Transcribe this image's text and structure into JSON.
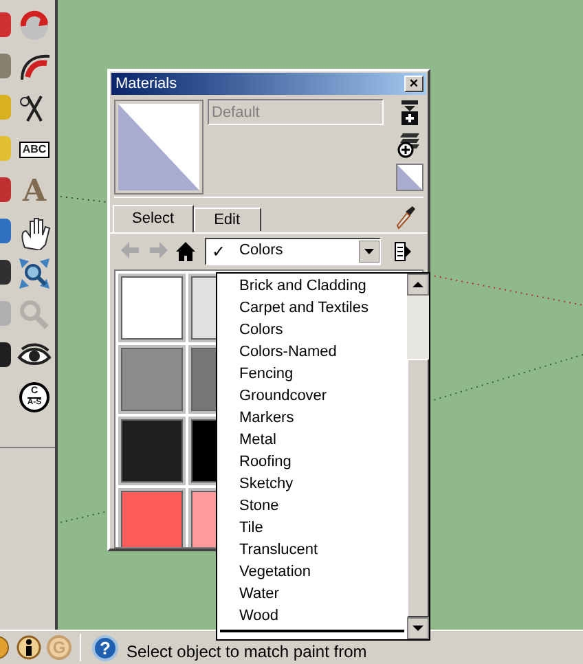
{
  "toolbar": {
    "left_tools": [
      {
        "color": "#d03030"
      },
      {
        "color": "#8a8070"
      },
      {
        "color": "#d8b020"
      },
      {
        "color": "#e0c030"
      },
      {
        "color": "#c03030"
      },
      {
        "color": "#3070c0"
      },
      {
        "color": "#303030"
      },
      {
        "color": "#b0b0b0"
      },
      {
        "color": "#202020"
      }
    ],
    "tools": [
      {
        "kind": "rotate",
        "disabled": false
      },
      {
        "kind": "offset",
        "disabled": false
      },
      {
        "kind": "tape",
        "disabled": false
      },
      {
        "kind": "text",
        "label": "ABC",
        "disabled": false
      },
      {
        "kind": "text3d",
        "label": "A",
        "disabled": false
      },
      {
        "kind": "pan",
        "disabled": false
      },
      {
        "kind": "zoom-extents",
        "disabled": false
      },
      {
        "kind": "zoom-window",
        "disabled": true
      },
      {
        "kind": "look-around",
        "disabled": false
      },
      {
        "kind": "section",
        "label": "C",
        "sublabel": "A-S",
        "disabled": false
      }
    ]
  },
  "materials": {
    "title": "Materials",
    "close": "×",
    "name": "Default",
    "tabs": [
      {
        "label": "Select",
        "selected": true
      },
      {
        "label": "Edit",
        "selected": false
      }
    ],
    "nav": [
      {
        "kind": "back",
        "disabled": true
      },
      {
        "kind": "forward",
        "disabled": true
      },
      {
        "kind": "home",
        "disabled": false
      }
    ],
    "collection": {
      "check": "✓",
      "value": "Colors"
    },
    "swatches": [
      {
        "color": "#ffffff"
      },
      {
        "color": "#e0e0e0"
      },
      {
        "color": "#8c8c8c"
      },
      {
        "color": "#777777"
      },
      {
        "color": "#1e1e1e"
      },
      {
        "color": "#000000"
      },
      {
        "color": "#ff5c5c"
      },
      {
        "color": "#ff9a9a"
      }
    ],
    "dropdown": [
      "Brick and Cladding",
      "Carpet and Textiles",
      "Colors",
      "Colors-Named",
      "Fencing",
      "Groundcover",
      "Markers",
      "Metal",
      "Roofing",
      "Sketchy",
      "Stone",
      "Tile",
      "Translucent",
      "Vegetation",
      "Water",
      "Wood"
    ]
  },
  "status_bar": {
    "help": "?",
    "google": "G",
    "text": "Select object to match paint from"
  }
}
